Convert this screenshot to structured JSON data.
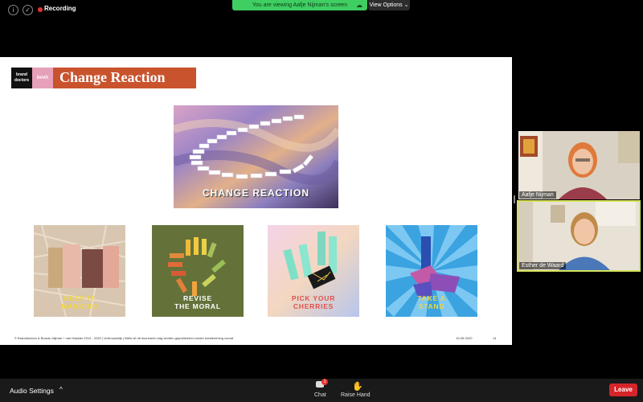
{
  "topbar": {
    "recording_label": "Recording",
    "banner_text": "You are viewing Aafje Nijman's screen",
    "view_options_label": "View Options"
  },
  "slide": {
    "logo_left": "brand doctors",
    "logo_right": "bvvh",
    "title": "Change Reaction",
    "hero_title": "CHANGE REACTION",
    "tiles": [
      {
        "label_line1": "KEEP IT",
        "label_line2": "MANKIND"
      },
      {
        "label_line1": "REVISE",
        "label_line2": "THE MORAL"
      },
      {
        "label_line1": "PICK YOUR",
        "label_line2": "CHERRIES"
      },
      {
        "label_line1": "TAKE A",
        "label_line2": "STAND"
      }
    ],
    "footer_left": "© Branddoctors & Bureau Nijman + van Haaster 2010 - 2020 | Vertrouwelijk | Niets uit dit document mag worden gepubliceerd zonder toestemming vooraf",
    "footer_date": "19-05-2020",
    "footer_page": "14"
  },
  "participants": [
    {
      "name": "Aafje Nijman"
    },
    {
      "name": "Esther de Waard"
    }
  ],
  "bottombar": {
    "audio_settings": "Audio Settings",
    "caret": "^",
    "chat_label": "Chat",
    "chat_badge": "1",
    "raise_hand_label": "Raise Hand",
    "leave_label": "Leave"
  },
  "colors": {
    "banner": "#3fce62",
    "title_bar": "#c9532d",
    "leave": "#d6252a",
    "active_speaker_border": "#d4e35a"
  }
}
